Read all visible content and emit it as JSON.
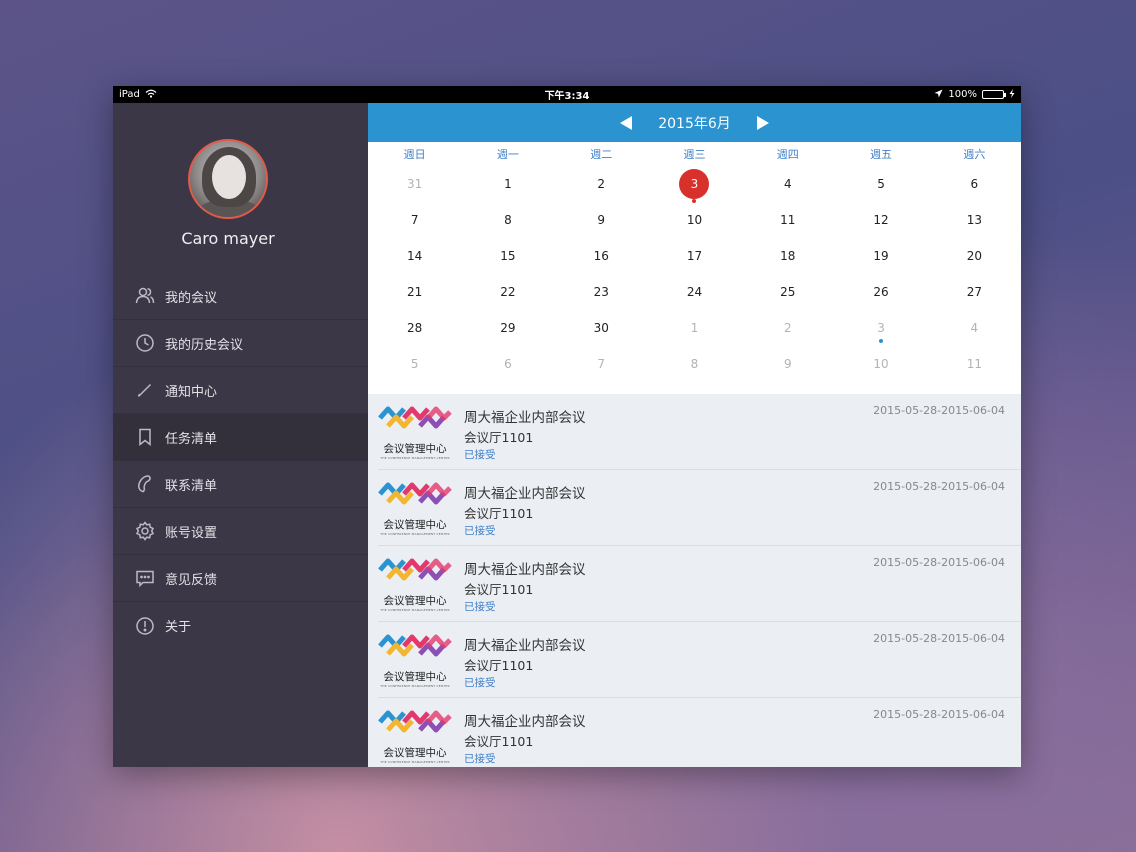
{
  "status_bar": {
    "device": "iPad",
    "time": "下午3:34",
    "battery": "100%",
    "colors": {
      "battery": "#5fd35b"
    }
  },
  "sidebar": {
    "user_name": "Caro mayer",
    "items": [
      {
        "label": "我的会议",
        "icon": "users-icon"
      },
      {
        "label": "我的历史会议",
        "icon": "clock-icon"
      },
      {
        "label": "通知中心",
        "icon": "pen-icon"
      },
      {
        "label": "任务清单",
        "icon": "bookmark-icon",
        "active": true
      },
      {
        "label": "联系清单",
        "icon": "phone-icon"
      },
      {
        "label": "账号设置",
        "icon": "gear-icon"
      },
      {
        "label": "意见反馈",
        "icon": "chat-icon"
      },
      {
        "label": "关于",
        "icon": "info-icon"
      }
    ]
  },
  "calendar": {
    "month_label": "2015年6月",
    "weekdays": [
      "週日",
      "週一",
      "週二",
      "週三",
      "週四",
      "週五",
      "週六"
    ],
    "days": [
      {
        "n": "31",
        "muted": true
      },
      {
        "n": "1"
      },
      {
        "n": "2"
      },
      {
        "n": "3",
        "today": true,
        "dot": true
      },
      {
        "n": "4"
      },
      {
        "n": "5"
      },
      {
        "n": "6"
      },
      {
        "n": "7"
      },
      {
        "n": "8"
      },
      {
        "n": "9"
      },
      {
        "n": "10"
      },
      {
        "n": "11"
      },
      {
        "n": "12"
      },
      {
        "n": "13"
      },
      {
        "n": "14"
      },
      {
        "n": "15"
      },
      {
        "n": "16"
      },
      {
        "n": "17"
      },
      {
        "n": "18"
      },
      {
        "n": "19"
      },
      {
        "n": "20"
      },
      {
        "n": "21"
      },
      {
        "n": "22"
      },
      {
        "n": "23"
      },
      {
        "n": "24"
      },
      {
        "n": "25"
      },
      {
        "n": "26"
      },
      {
        "n": "27"
      },
      {
        "n": "28"
      },
      {
        "n": "29"
      },
      {
        "n": "30"
      },
      {
        "n": "1",
        "muted": true
      },
      {
        "n": "2",
        "muted": true
      },
      {
        "n": "3",
        "muted": true,
        "dot": true
      },
      {
        "n": "4",
        "muted": true
      },
      {
        "n": "5",
        "muted": true
      },
      {
        "n": "6",
        "muted": true
      },
      {
        "n": "7",
        "muted": true
      },
      {
        "n": "8",
        "muted": true
      },
      {
        "n": "9",
        "muted": true
      },
      {
        "n": "10",
        "muted": true
      },
      {
        "n": "11",
        "muted": true
      }
    ],
    "colors": {
      "header": "#2a93d0",
      "today": "#d8302a",
      "weekday_text": "#3f7fc9"
    }
  },
  "meetings": [
    {
      "title": "周大福企业内部会议",
      "room": "会议厅1101",
      "status": "已接受",
      "date_range": "2015-05-28-2015-06-04",
      "logo_text": "会议管理中心",
      "logo_sub": "THE CONFERENCE MANAGEMENT CENTER"
    },
    {
      "title": "周大福企业内部会议",
      "room": "会议厅1101",
      "status": "已接受",
      "date_range": "2015-05-28-2015-06-04",
      "logo_text": "会议管理中心",
      "logo_sub": "THE CONFERENCE MANAGEMENT CENTER"
    },
    {
      "title": "周大福企业内部会议",
      "room": "会议厅1101",
      "status": "已接受",
      "date_range": "2015-05-28-2015-06-04",
      "logo_text": "会议管理中心",
      "logo_sub": "THE CONFERENCE MANAGEMENT CENTER"
    },
    {
      "title": "周大福企业内部会议",
      "room": "会议厅1101",
      "status": "已接受",
      "date_range": "2015-05-28-2015-06-04",
      "logo_text": "会议管理中心",
      "logo_sub": "THE CONFERENCE MANAGEMENT CENTER"
    },
    {
      "title": "周大福企业内部会议",
      "room": "会议厅1101",
      "status": "已接受",
      "date_range": "2015-05-28-2015-06-04",
      "logo_text": "会议管理中心",
      "logo_sub": "THE CONFERENCE MANAGEMENT CENTER"
    }
  ]
}
